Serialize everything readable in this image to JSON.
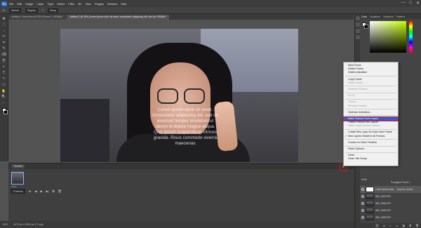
{
  "menubar": {
    "logo": "Ps",
    "items": [
      "File",
      "Edit",
      "Image",
      "Layer",
      "Type",
      "Select",
      "Filter",
      "3D",
      "View",
      "Plugins",
      "Window",
      "Help"
    ],
    "window_controls": [
      "—",
      "□",
      "✕"
    ]
  },
  "options_bar": {
    "fields": [
      "Normal",
      "Regular",
      "T",
      "Sharp"
    ],
    "size_label": "T"
  },
  "doc_tabs": [
    {
      "label": "Untitled-1 Recovered @ 25% (Frame 1, RGB/8) *",
      "active": false
    },
    {
      "label": "Untitled-2 @ 25% (Lorem ipsum dolor sit amet, consectetur adipiscing elit, sed do, RGB/8) *",
      "active": true
    }
  ],
  "tools": [
    "✥",
    "⬚",
    "◌",
    "✂",
    "⌗",
    "✎",
    "⌫",
    "⎘",
    "◐",
    "T",
    "↖",
    "▭",
    "✋",
    "🔍",
    "⋯"
  ],
  "canvas": {
    "overlay_text": "Lorem ipsum dolor sit amet, consectetur adipiscing elit, sed do eiusmod tempor incididunt ut labore et dolore magna aliqua. Quis ipsum suspendisse ultrices gravida. Risus commodo viverra maecenas"
  },
  "timeline": {
    "tab_label": "Timeline",
    "menu_icon": "≡",
    "frame_label": "0 sec.",
    "loop_label": "Forever",
    "controls": [
      "⏮",
      "◀",
      "▶",
      "▶|",
      "⧉",
      "🗑"
    ]
  },
  "status_bar": {
    "zoom": "25%",
    "doc_size": "4472 px x 2516 px (72 ppi)"
  },
  "right_panel": {
    "tabs": [
      "Color",
      "Swatches",
      "Gradients",
      "Patterns"
    ]
  },
  "layers": {
    "options": [
      "Unify:",
      "Propagate Frame 1"
    ],
    "rows": [
      {
        "name": "Lorem ipsum dolor ... cing elit, sed do",
        "selected": true,
        "thumb": "text"
      },
      {
        "name": "IMG_0323.JPG",
        "selected": false,
        "thumb": "photo"
      },
      {
        "name": "IMG_0325.JPG",
        "selected": false,
        "thumb": "photo"
      },
      {
        "name": "IMG_0326.JPG",
        "selected": false,
        "thumb": "photo"
      },
      {
        "name": "IMG_0328.JPG",
        "selected": false,
        "thumb": "photo"
      }
    ],
    "footer_icons": [
      "⛓",
      "fx",
      "◐",
      "▭",
      "▦",
      "⧉",
      "🗑"
    ]
  },
  "context_menu": {
    "items": [
      {
        "label": "New Frame",
        "state": "normal"
      },
      {
        "label": "Delete Frame",
        "state": "normal"
      },
      {
        "label": "Delete Animation",
        "state": "normal"
      },
      {
        "sep": true
      },
      {
        "label": "Copy Frame",
        "state": "normal"
      },
      {
        "label": "Paste Frame...",
        "state": "disabled"
      },
      {
        "sep": true
      },
      {
        "label": "Select All Frames",
        "state": "disabled"
      },
      {
        "sep": true
      },
      {
        "label": "Go To",
        "state": "disabled"
      },
      {
        "sep": true
      },
      {
        "label": "Tween...",
        "state": "disabled"
      },
      {
        "label": "Reverse Frames",
        "state": "disabled"
      },
      {
        "sep": true
      },
      {
        "label": "Optimize Animation...",
        "state": "normal"
      },
      {
        "sep": true
      },
      {
        "label": "Make Frames From Layers",
        "state": "highlighted"
      },
      {
        "label": "Flatten Frames Into Layers",
        "state": "normal"
      },
      {
        "label": "Match Layer Across Frames...",
        "state": "disabled"
      },
      {
        "sep": true
      },
      {
        "label": "Create New Layer for Each New Frame",
        "state": "normal"
      },
      {
        "label": "New Layers Visible in All Frames",
        "state": "checked"
      },
      {
        "sep": true
      },
      {
        "label": "Convert to Video Timeline",
        "state": "normal"
      },
      {
        "sep": true
      },
      {
        "label": "Panel Options...",
        "state": "normal"
      },
      {
        "sep": true
      },
      {
        "label": "Close",
        "state": "normal"
      },
      {
        "label": "Close Tab Group",
        "state": "normal"
      }
    ]
  }
}
